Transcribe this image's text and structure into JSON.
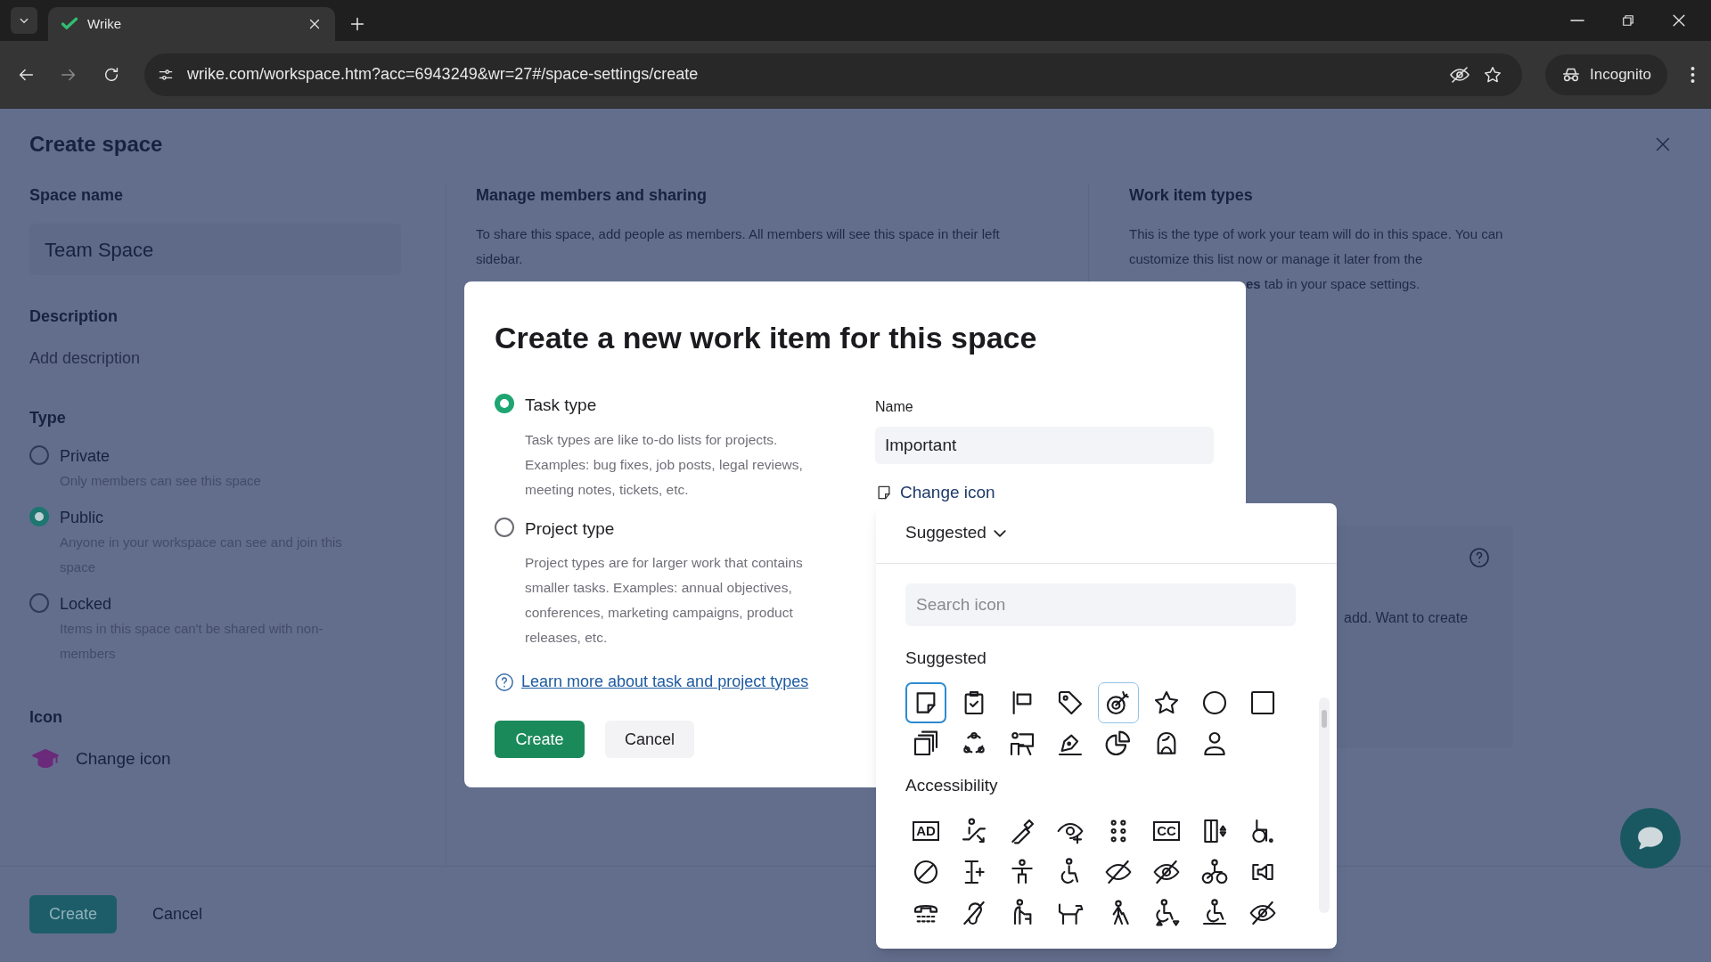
{
  "browser": {
    "tab_title": "Wrike",
    "url": "wrike.com/workspace.htm?acc=6943249&wr=27#/space-settings/create",
    "profile": "Incognito"
  },
  "page": {
    "title": "Create space",
    "space_name": {
      "label": "Space name",
      "value": "Team Space"
    },
    "description": {
      "label": "Description",
      "placeholder": "Add description"
    },
    "type": {
      "label": "Type",
      "options": [
        {
          "label": "Private",
          "description": "Only members can see this space",
          "selected": false
        },
        {
          "label": "Public",
          "description": "Anyone in your workspace can see and join this space",
          "selected": true
        },
        {
          "label": "Locked",
          "description": "Items in this space can't be shared with non-members",
          "selected": false
        }
      ]
    },
    "icon": {
      "label": "Icon",
      "action": "Change icon"
    },
    "buttons": [
      "Create",
      "Cancel"
    ],
    "members": {
      "title": "Manage members and sharing",
      "text": "To share this space, add people as members. All members will see this space in their left sidebar."
    },
    "work_item_types": {
      "title": "Work item types",
      "text": "This is the type of work your team will do in this space. You can customize this list now or manage it later from the",
      "text_continued": "**es** tab in your space settings."
    },
    "card_text": "add. Want to create"
  },
  "dialog": {
    "title": "Create a new work item for this space",
    "work_types": [
      {
        "label": "Task type",
        "description": "Task types are like to-do lists for projects. Examples: bug fixes, job posts, legal reviews, meeting notes, tickets, etc.",
        "selected": true
      },
      {
        "label": "Project type",
        "description": "Project types are for larger work that contains smaller tasks. Examples: annual objectives, conferences, marketing campaigns, product releases, etc.",
        "selected": false
      }
    ],
    "learn_more": "Learn more about task and project types",
    "buttons": [
      "Create",
      "Cancel"
    ],
    "name": {
      "label": "Name",
      "value": "Important"
    },
    "change_icon": "Change icon"
  },
  "icon_picker": {
    "dropdown": "Suggested",
    "search": {
      "placeholder": "Search icon"
    },
    "groups": [
      {
        "title": "Suggested",
        "icons": [
          {
            "selected": true,
            "hovered": false
          },
          {
            "selected": false,
            "hovered": false
          },
          {
            "selected": false,
            "hovered": false
          },
          {
            "selected": false,
            "hovered": false
          },
          {
            "selected": false,
            "hovered": true
          },
          {
            "selected": false,
            "hovered": false
          },
          {
            "selected": false,
            "hovered": false
          },
          {
            "selected": false,
            "hovered": false
          },
          {
            "selected": false,
            "hovered": false
          },
          {
            "selected": false,
            "hovered": false
          },
          {
            "selected": false,
            "hovered": false
          },
          {
            "selected": false,
            "hovered": false
          },
          {
            "selected": false,
            "hovered": false
          },
          {
            "selected": false,
            "hovered": false
          },
          {
            "selected": false,
            "hovered": false
          }
        ]
      },
      {
        "title": "Accessibility",
        "icons": [
          {
            "selected": false,
            "hovered": false,
            "label": "AD"
          },
          {
            "selected": false,
            "hovered": false
          },
          {
            "selected": false,
            "hovered": false
          },
          {
            "selected": false,
            "hovered": false
          },
          {
            "selected": false,
            "hovered": false
          },
          {
            "selected": false,
            "hovered": false,
            "label": "CC"
          },
          {
            "selected": false,
            "hovered": false
          },
          {
            "selected": false,
            "hovered": false
          },
          {
            "selected": false,
            "hovered": false
          },
          {
            "selected": false,
            "hovered": false
          },
          {
            "selected": false,
            "hovered": false
          },
          {
            "selected": false,
            "hovered": false
          },
          {
            "selected": false,
            "hovered": false
          },
          {
            "selected": false,
            "hovered": false
          },
          {
            "selected": false,
            "hovered": false
          },
          {
            "selected": false,
            "hovered": false
          },
          {
            "selected": false,
            "hovered": false
          },
          {
            "selected": false,
            "hovered": false
          },
          {
            "selected": false,
            "hovered": false
          },
          {
            "selected": false,
            "hovered": false
          },
          {
            "selected": false,
            "hovered": false
          },
          {
            "selected": false,
            "hovered": false
          },
          {
            "selected": false,
            "hovered": false
          },
          {
            "selected": false,
            "hovered": false
          }
        ]
      }
    ]
  }
}
